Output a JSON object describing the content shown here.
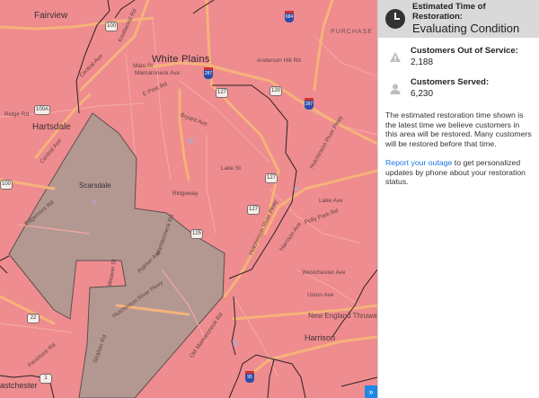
{
  "map": {
    "places": {
      "fairview": "Fairview",
      "white_plains": "White Plains",
      "hartsdale": "Hartsdale",
      "scarsdale": "Scarsdale",
      "harrison": "Harrison",
      "purchase": "PURCHASE",
      "eastchester": "astchester"
    },
    "roads": {
      "central_ave_n": "Central Ave",
      "central_ave_s": "Central Ave",
      "main_st": "Main St",
      "mamaroneck_ave": "Mamaroneck Ave",
      "e_post_rd": "E Post Rd",
      "knollwood_rd": "Knollwood Rd",
      "anderson_hill_rd": "Anderson Hill Rd",
      "bryant_ave": "Bryant Ave",
      "ridge_rd": "Ridge Rd",
      "lake_st": "Lake St",
      "ridgeway": "Ridgeway",
      "hutch_river_pkwy_1": "Hutchinson River Pkwy",
      "hutch_river_pkwy_2": "Hutchinson River Pkwy",
      "hutch_river_pkwy_3": "Hutchinson River Pkwy",
      "new_england_thwy": "New England Thruway",
      "mamaroneck_rd": "Mamaroneck Rd",
      "palmer_ave": "Palmer Ave",
      "weaver_st": "Weaver St",
      "stratton_rd": "Stratton Rd",
      "old_mamaroneck_rd": "Old Mamaroneck Rd",
      "harrison_ave": "Harrison Ave",
      "lake_ave": "Lake Ave",
      "polly_park_rd": "Polly Park Rd",
      "fenimore_rd": "Fenimore Rd",
      "edgemont": "Edgemont Rd",
      "union_ave": "Union Ave",
      "westchester_ave": "Westchester Ave"
    },
    "shields": {
      "r100_top": "100",
      "r100a": "100A",
      "r100_left": "100",
      "r22": "22",
      "r127_a": "127",
      "r127_b": "127",
      "r127_c": "127",
      "r120": "120",
      "i287_a": "287",
      "i287_b": "287",
      "i684": "684",
      "i95": "95",
      "r125": "125",
      "r1": "1"
    },
    "colors": {
      "background": "#ef8c8f",
      "outage_area": "#a89a93",
      "roads": "#f5b37a",
      "boundaries": "#2a2025"
    }
  },
  "panel": {
    "restoration_title": "Estimated Time of Restoration:",
    "restoration_value": "Evaluating Condition",
    "out_title": "Customers Out of Service:",
    "out_value": "2,188",
    "served_title": "Customers Served:",
    "served_value": "6,230",
    "disclaimer": "The estimated restoration time shown is the latest time we believe customers in this area will be restored. Many customers will be restored before that time.",
    "report_link": "Report your outage",
    "report_text": " to get personalized updates by phone about your restoration status."
  }
}
